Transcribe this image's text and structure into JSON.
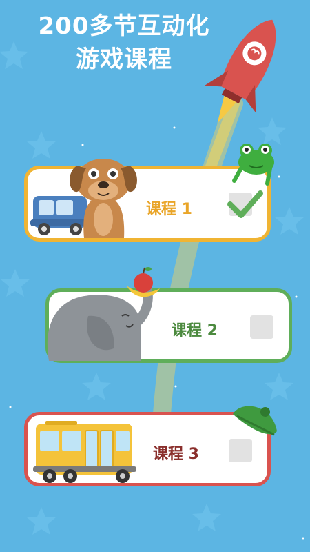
{
  "header": {
    "title_line1": "200多节互动化",
    "title_line2": "游戏课程"
  },
  "lessons": [
    {
      "label": "课程 1",
      "completed": true,
      "color": "#f0b433",
      "icon": "dog-car-icon"
    },
    {
      "label": "课程 2",
      "completed": false,
      "color": "#5fae5a",
      "icon": "elephant-icon"
    },
    {
      "label": "课程 3",
      "completed": false,
      "color": "#d9534f",
      "icon": "school-bus-icon"
    }
  ],
  "colors": {
    "background": "#5cb5e3",
    "rocket": "#d9534f",
    "check": "#5fae5a"
  }
}
